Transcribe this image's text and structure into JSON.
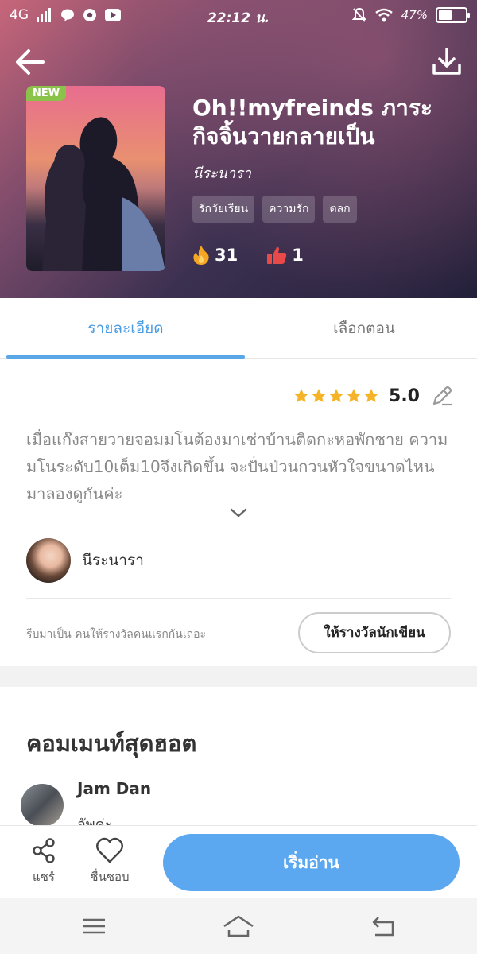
{
  "status_bar": {
    "network": "4G",
    "time": "22:12 น.",
    "battery": "47%"
  },
  "book": {
    "badge": "NEW",
    "title": "Oh!!myfreinds ภาระกิจจิ้นวายกลายเป็น",
    "author": "นีระนารา",
    "tags": [
      "รักวัยเรียน",
      "ความรัก",
      "ตลก"
    ],
    "hot_count": "31",
    "like_count": "1"
  },
  "tabs": {
    "details": "รายละเอียด",
    "chapters": "เลือกตอน"
  },
  "detail": {
    "rating": "5.0",
    "rating_stars": 5,
    "description": "เมื่อแก๊งสายวายจอมมโนต้องมาเช่าบ้านติดกะหอพักชาย ความมโนระดับ10เต็ม10จึงเกิดขึ้น จะปั่นป่วนกวนหัวใจขนาดไหน มาลองดูกันค่ะ",
    "author_name": "นีระนารา",
    "reward_text": "รีบมาเป็น คนให้รางวัลคนแรกกันเถอะ",
    "reward_button": "ให้รางวัลนักเขียน"
  },
  "comments": {
    "title": "คอมเมนท์สุดฮอต",
    "items": [
      {
        "name": "Jam Dan",
        "text": "อัพค่ะ"
      }
    ]
  },
  "actions": {
    "share": "แชร์",
    "like": "ชื่นชอบ",
    "read": "เริ่มอ่าน"
  },
  "colors": {
    "accent": "#5ba8f0",
    "tab_active": "#4a9de3",
    "star": "#f5b428",
    "badge_new": "#8bc34a",
    "hero_dark": "#23203a",
    "hero_pink": "#c7667a"
  },
  "icons": {
    "back": "arrow-left-icon",
    "download": "download-icon",
    "fire": "fire-icon",
    "thumbs_up": "thumbs-up-icon",
    "edit": "pencil-icon",
    "expand": "chevron-down-icon",
    "share": "share-icon",
    "like": "heart-icon"
  }
}
